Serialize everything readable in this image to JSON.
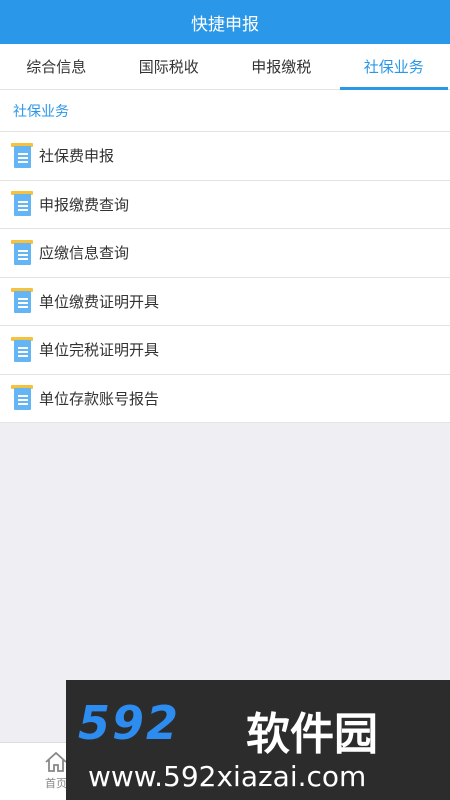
{
  "header": {
    "title": "快捷申报"
  },
  "tabs": [
    {
      "label": "综合信息"
    },
    {
      "label": "国际税收"
    },
    {
      "label": "申报缴税"
    },
    {
      "label": "社保业务"
    }
  ],
  "active_tab": "社保业务",
  "section": {
    "title": "社保业务"
  },
  "items": [
    {
      "label": "社保费申报",
      "icon": "document-icon"
    },
    {
      "label": "申报缴费查询",
      "icon": "document-icon"
    },
    {
      "label": "应缴信息查询",
      "icon": "document-icon"
    },
    {
      "label": "单位缴费证明开具",
      "icon": "document-icon"
    },
    {
      "label": "单位完税证明开具",
      "icon": "document-icon"
    },
    {
      "label": "单位存款账号报告",
      "icon": "document-icon"
    }
  ],
  "bottom_nav": {
    "home_label": "首页"
  },
  "watermark": {
    "brand_num": "592",
    "brand_text": "软件园",
    "url": "www.592xiazai.com"
  },
  "colors": {
    "accent": "#2a97e8",
    "icon_blue": "#63b5f5",
    "icon_yellow": "#f6c23c"
  }
}
